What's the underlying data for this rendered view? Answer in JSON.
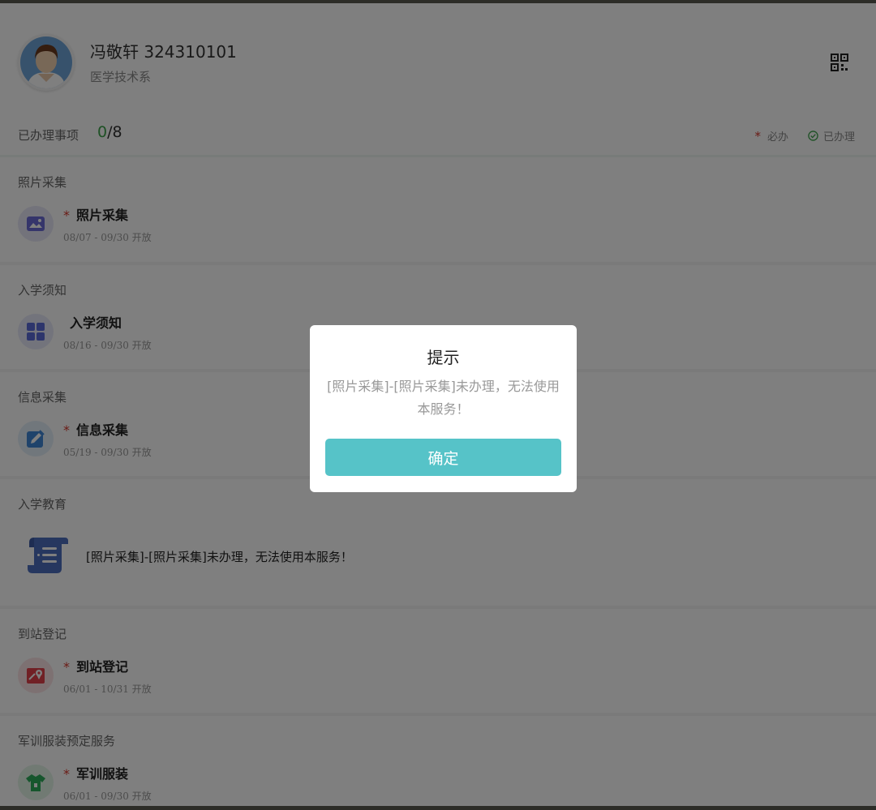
{
  "user": {
    "name": "冯敬轩 324310101",
    "dept": "医学技术系"
  },
  "status": {
    "label": "已办理事项",
    "done": "0",
    "total": "/8",
    "legend_required": "必办",
    "legend_done": "已办理",
    "required_mark": "*"
  },
  "sections": [
    {
      "title": "照片采集",
      "item": {
        "required": "*",
        "title": "照片采集",
        "date": "08/07 - 09/30 开放",
        "icon": "image-icon",
        "color": "#6b6bd6"
      }
    },
    {
      "title": "入学须知",
      "item": {
        "required": "",
        "title": "入学须知",
        "date": "08/16 - 09/30 开放",
        "icon": "grid-icon",
        "color": "#5a6bd8"
      }
    },
    {
      "title": "信息采集",
      "item": {
        "required": "*",
        "title": "信息采集",
        "date": "05/19 - 09/30 开放",
        "icon": "edit-icon",
        "color": "#3e86d6"
      }
    },
    {
      "title": "入学教育",
      "message": "[照片采集]-[照片采集]未办理，无法使用本服务！",
      "icon": "scroll-icon"
    },
    {
      "title": "到站登记",
      "item": {
        "required": "*",
        "title": "到站登记",
        "date": "06/01 - 10/31 开放",
        "icon": "map-pin-icon",
        "color": "#e2414a"
      }
    },
    {
      "title": "军训服装预定服务",
      "item": {
        "required": "*",
        "title": "军训服装",
        "date": "06/01 - 09/30 开放",
        "icon": "shirt-icon",
        "color": "#2cad5a"
      }
    }
  ],
  "dialog": {
    "title": "提示",
    "message": "[照片采集]-[照片采集]未办理，无法使用本服务！",
    "confirm": "确定"
  }
}
